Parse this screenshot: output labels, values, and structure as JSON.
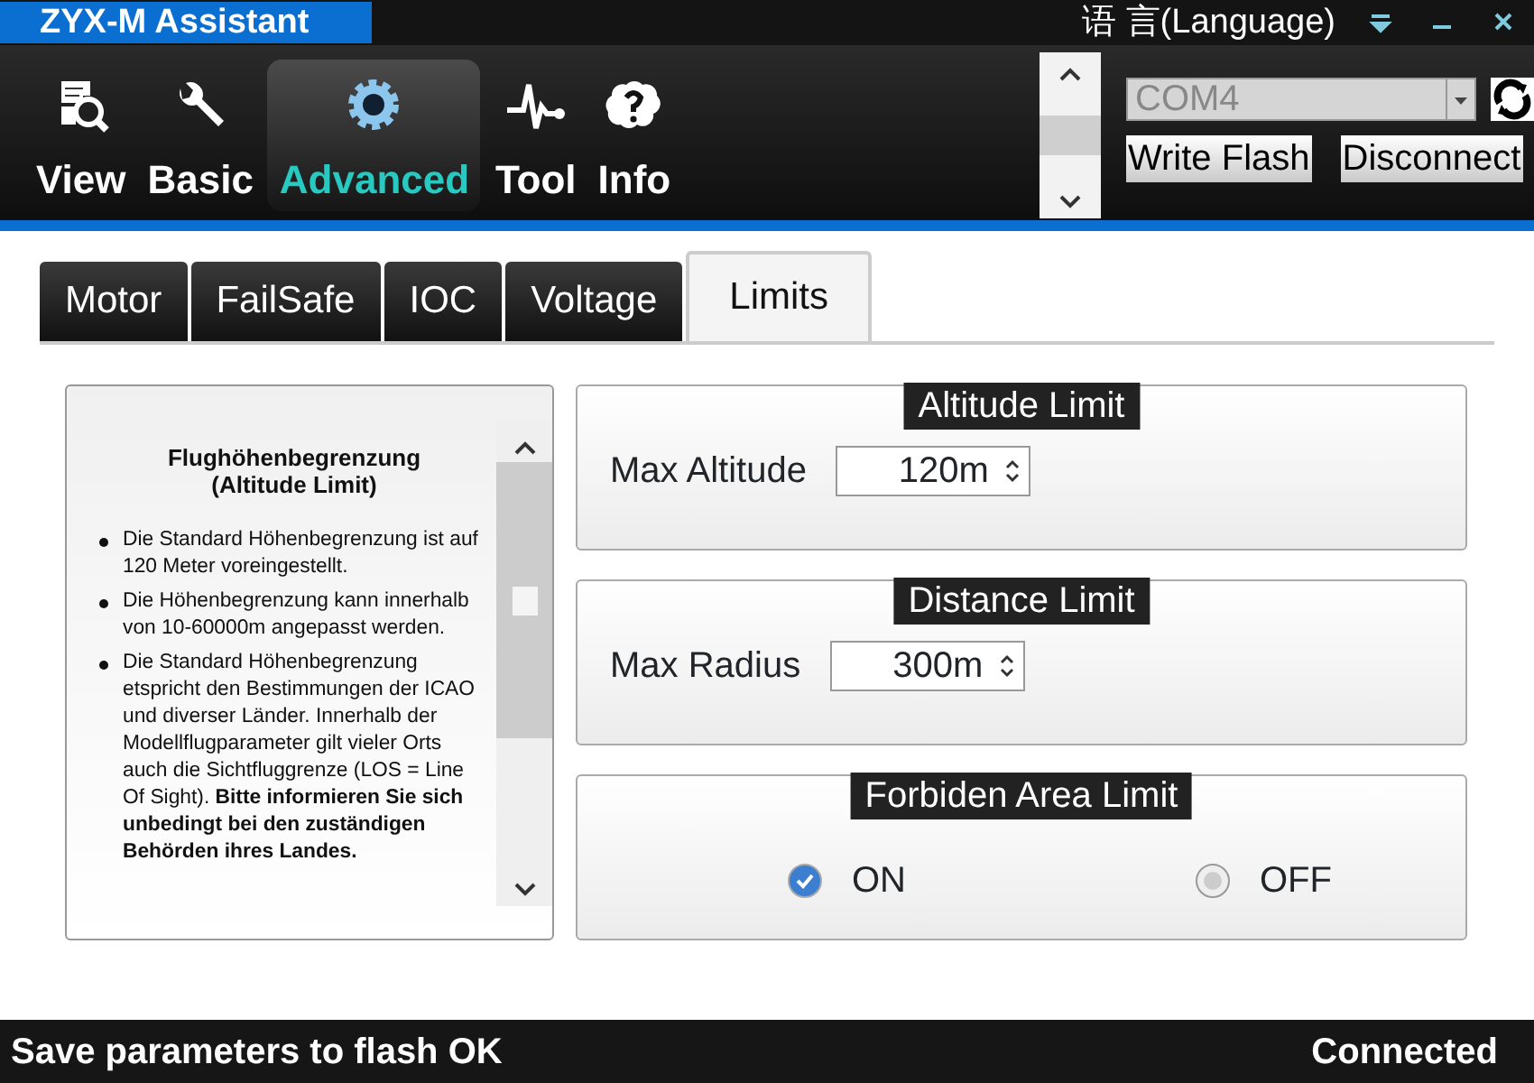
{
  "window": {
    "title": "ZYX-M Assistant",
    "language": "语 言(Language)"
  },
  "toolbar": [
    {
      "label": "View",
      "selected": false
    },
    {
      "label": "Basic",
      "selected": false
    },
    {
      "label": "Advanced",
      "selected": true
    },
    {
      "label": "Tool",
      "selected": false
    },
    {
      "label": "Info",
      "selected": false
    }
  ],
  "connection": {
    "port": "COM4",
    "buttons": [
      "Write Flash",
      "Disconnect"
    ]
  },
  "tabs": [
    {
      "label": "Motor",
      "selected": false
    },
    {
      "label": "FailSafe",
      "selected": false
    },
    {
      "label": "IOC",
      "selected": false
    },
    {
      "label": "Voltage",
      "selected": false
    },
    {
      "label": "Limits",
      "selected": true
    }
  ],
  "help": {
    "title": "Flughöhenbegrenzung",
    "subtitle": "(Altitude Limit)",
    "bullets": [
      "Die Standard Höhenbegrenzung ist auf 120 Meter voreingestellt.",
      "Die Höhenbegrenzung kann innerhalb von 10-60000m angepasst werden.",
      "Die Standard Höhenbegrenzung etspricht den Bestimmungen der ICAO und diverser Länder. Innerhalb der Modellflugparameter gilt vieler Orts auch die Sichtfluggrenze (LOS = Line Of Sight). **Bitte informieren Sie sich unbedingt bei den zuständigen Behörden ihres Landes.**"
    ]
  },
  "groups": [
    {
      "kind": "spinner",
      "title": "Altitude Limit",
      "label": "Max Altitude",
      "value": "120m"
    },
    {
      "kind": "spinner",
      "title": "Distance Limit",
      "label": "Max Radius",
      "value": "300m"
    },
    {
      "kind": "radio",
      "title": "Forbiden Area Limit",
      "options": [
        {
          "label": "ON",
          "selected": true
        },
        {
          "label": "OFF",
          "selected": false
        }
      ]
    }
  ],
  "status_bar": {
    "message": "Save parameters to flash OK",
    "state": "Connected"
  }
}
